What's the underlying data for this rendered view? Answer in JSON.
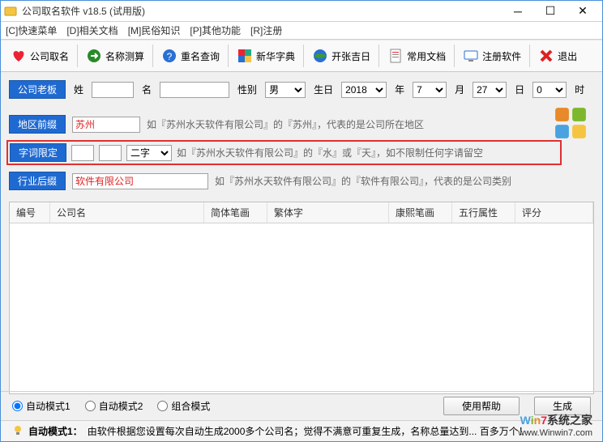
{
  "titlebar": {
    "text": "公司取名软件 v18.5 (试用版)"
  },
  "menu": {
    "quick": "[C]快速菜单",
    "docs": "[D]相关文档",
    "folk": "[M]民俗知识",
    "other": "[P]其他功能",
    "reg": "[R]注册"
  },
  "toolbar": {
    "naming": "公司取名",
    "test": "名称测算",
    "dup": "重名查询",
    "dict": "新华字典",
    "luck": "开张吉日",
    "doc": "常用文档",
    "regsw": "注册软件",
    "exit": "退出"
  },
  "form": {
    "boss_label": "公司老板",
    "surname": "姓",
    "given": "名",
    "gender_label": "性别",
    "gender_value": "男",
    "birth_label": "生日",
    "year": "2018",
    "year_suffix": "年",
    "month": "7",
    "month_suffix": "月",
    "day": "27",
    "day_suffix": "日",
    "hour": "0",
    "hour_suffix": "时",
    "region_label": "地区前缀",
    "region_value": "苏州",
    "region_hint": "如『苏州水天软件有限公司』的『苏州』，代表的是公司所在地区",
    "wordlimit_label": "字词限定",
    "wordlimit_sel": "二字",
    "wordlimit_hint": "如『苏州水天软件有限公司』的『水』或『天』，如不限制任何字请留空",
    "suffix_label": "行业后缀",
    "suffix_value": "软件有限公司",
    "suffix_hint": "如『苏州水天软件有限公司』的『软件有限公司』，代表的是公司类别"
  },
  "columns": {
    "c1": "编号",
    "c2": "公司名",
    "c3": "简体笔画",
    "c4": "繁体字",
    "c5": "康熙笔画",
    "c6": "五行属性",
    "c7": "评分"
  },
  "modes": {
    "m1": "自动模式1",
    "m2": "自动模式2",
    "m3": "组合模式"
  },
  "buttons": {
    "help": "使用帮助",
    "gen": "生成"
  },
  "status": {
    "icon_tip": "自动模式1：",
    "text": "由软件根据您设置每次自动生成2000多个公司名；觉得不满意可重复生成，名称总量达到... 百多万个！"
  },
  "watermark": {
    "brand_prefix": "W",
    "brand_i": "i",
    "brand_n": "n",
    "brand_7": "7",
    "brand_suffix": "系统之家",
    "url": "www.Winwin7.com"
  }
}
